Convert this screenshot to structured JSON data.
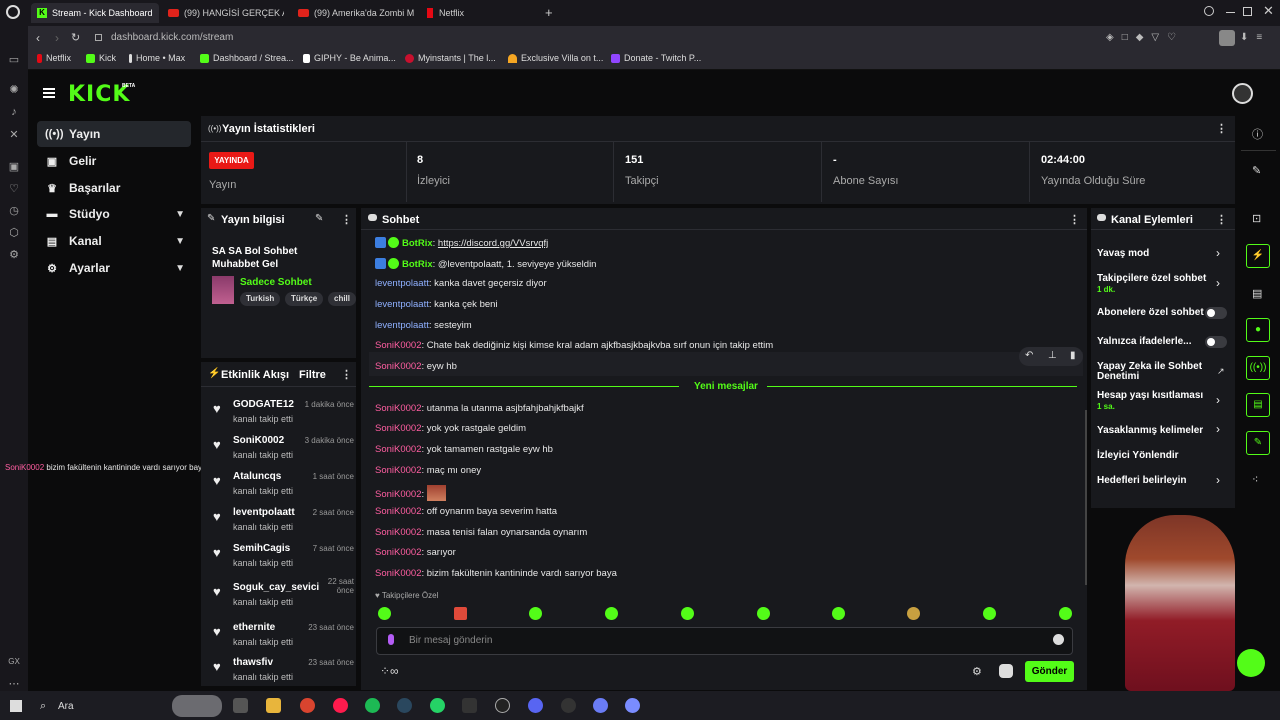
{
  "browser": {
    "tabs": [
      {
        "label": "Stream - Kick Dashboard",
        "active": true
      },
      {
        "label": "(99) HANGİSİ GERÇEK A..."
      },
      {
        "label": "(99) Amerika'da Zombi M..."
      },
      {
        "label": "Netflix"
      }
    ],
    "new_tab": "+",
    "url": "dashboard.kick.com/stream",
    "bookmarks": [
      "Netflix",
      "Kick",
      "Home • Max",
      "Dashboard / Strea...",
      "GIPHY - Be Anima...",
      "Myinstants | The l...",
      "Exclusive Villa on t...",
      "Donate - Twitch P..."
    ]
  },
  "logo": "KICK",
  "logo_beta": "BETA",
  "nav": [
    {
      "label": "Yayın",
      "icon": "broadcast-icon"
    },
    {
      "label": "Gelir",
      "icon": "revenue-icon"
    },
    {
      "label": "Başarılar",
      "icon": "trophy-icon"
    },
    {
      "label": "Stüdyo",
      "icon": "studio-icon"
    },
    {
      "label": "Kanal",
      "icon": "channel-icon"
    },
    {
      "label": "Ayarlar",
      "icon": "gear-icon"
    }
  ],
  "stats": {
    "title": "Yayın İstatistikleri",
    "live_badge": "YAYINDA",
    "items": [
      {
        "value": "",
        "label": "Yayın"
      },
      {
        "value": "8",
        "label": "İzleyici"
      },
      {
        "value": "151",
        "label": "Takipçi"
      },
      {
        "value": "-",
        "label": "Abone Sayısı"
      },
      {
        "value": "02:44:00",
        "label": "Yayında Olduğu Süre"
      }
    ]
  },
  "stream_info": {
    "title": "Yayın bilgisi",
    "stream_title": "SA SA Bol Sohbet Muhabbet Gel",
    "category": "Sadece Sohbet",
    "tags": [
      "Turkish",
      "Türkçe",
      "chill"
    ]
  },
  "activity": {
    "title": "Etkinlik Akışı",
    "filter": "Filtre",
    "items": [
      {
        "name": "GODGATE12",
        "action": "kanalı takip etti",
        "time": "1 dakika önce"
      },
      {
        "name": "SoniK0002",
        "action": "kanalı takip etti",
        "time": "3 dakika önce"
      },
      {
        "name": "Ataluncqs",
        "action": "kanalı takip etti",
        "time": "1 saat önce"
      },
      {
        "name": "leventpolaatt",
        "action": "kanalı takip etti",
        "time": "2 saat önce"
      },
      {
        "name": "SemihCagis",
        "action": "kanalı takip etti",
        "time": "7 saat önce"
      },
      {
        "name": "Soguk_cay_sevici",
        "action": "kanalı takip etti",
        "time": "22 saat önce"
      },
      {
        "name": "ethernite",
        "action": "kanalı takip etti",
        "time": "23 saat önce"
      },
      {
        "name": "thawsfiv",
        "action": "kanalı takip etti",
        "time": "23 saat önce"
      }
    ]
  },
  "chat": {
    "title": "Sohbet",
    "new_messages": "Yeni mesajlar",
    "followers_only": "Takipçilere Özel",
    "placeholder": "Bir mesaj gönderin",
    "send": "Gönder",
    "messages": [
      {
        "user": "BotRix",
        "text": "https://discord.gg/VVsrvqfj",
        "color": "green",
        "bot": true
      },
      {
        "user": "BotRix",
        "text": "@leventpolaatt, 1. seviyeye yükseldin",
        "color": "green",
        "bot": true
      },
      {
        "user": "leventpolaatt",
        "text": "kanka davet geçersiz diyor",
        "color": "blue"
      },
      {
        "user": "leventpolaatt",
        "text": "kanka çek beni",
        "color": "blue"
      },
      {
        "user": "leventpolaatt",
        "text": "sesteyim",
        "color": "blue"
      },
      {
        "user": "SoniK0002",
        "text": "Chate bak dediğiniz kişi kimse kral adam ajkfbasjkbajkvba sırf onun için takip ettim",
        "color": "pink"
      },
      {
        "user": "SoniK0002",
        "text": "eyw hb",
        "color": "pink"
      },
      {
        "user": "SoniK0002",
        "text": "utanma la utanma asjbfahjbahjkfbajkf",
        "color": "pink"
      },
      {
        "user": "SoniK0002",
        "text": "yok yok rastgale geldim",
        "color": "pink"
      },
      {
        "user": "SoniK0002",
        "text": "yok tamamen rastgale eyw hb",
        "color": "pink"
      },
      {
        "user": "SoniK0002",
        "text": "maç mı oney",
        "color": "pink"
      },
      {
        "user": "SoniK0002",
        "text": "",
        "color": "pink",
        "emote": true
      },
      {
        "user": "SoniK0002",
        "text": "off oynarım baya severim hatta",
        "color": "pink"
      },
      {
        "user": "SoniK0002",
        "text": "masa tenisi falan oynarsanda oynarım",
        "color": "pink"
      },
      {
        "user": "SoniK0002",
        "text": "sarıyor",
        "color": "pink"
      },
      {
        "user": "SoniK0002",
        "text": "bizim fakültenin kantininde vardı sarıyor baya",
        "color": "pink"
      }
    ]
  },
  "overlay_chat": {
    "user": "SoniK0002",
    "text": "bizim fakültenin kantininde vardı sarıyor baya"
  },
  "actions": {
    "title": "Kanal Eylemleri",
    "items": [
      {
        "label": "Yavaş mod",
        "kind": "chevron"
      },
      {
        "label": "Takipçilere özel sohbet",
        "sub": "1 dk.",
        "kind": "chevron"
      },
      {
        "label": "Abonelere özel sohbet",
        "kind": "toggle"
      },
      {
        "label": "Yalnızca ifadelerle...",
        "kind": "toggle"
      },
      {
        "label": "Yapay Zeka ile Sohbet Denetimi",
        "kind": "external"
      },
      {
        "label": "Hesap yaşı kısıtlaması",
        "sub": "1 sa.",
        "kind": "chevron"
      },
      {
        "label": "Yasaklanmış kelimeler",
        "kind": "chevron"
      },
      {
        "label": "İzleyici Yönlendir",
        "kind": "none"
      },
      {
        "label": "Hedefleri belirleyin",
        "kind": "chevron"
      }
    ]
  },
  "taskbar": {
    "search": "Ara"
  },
  "colors": {
    "accent": "#53fc18",
    "live": "#e91916",
    "panel": "#18191d"
  }
}
